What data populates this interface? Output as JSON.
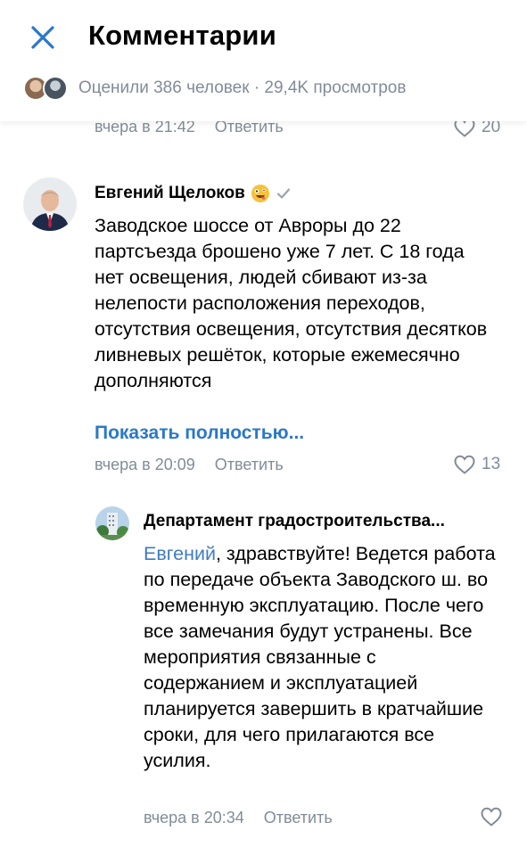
{
  "header": {
    "title": "Комментарии",
    "stats": "Оценили 386 человек · 29,4K просмотров"
  },
  "prev_comment": {
    "time": "вчера в 21:42",
    "reply_label": "Ответить",
    "likes": "20"
  },
  "comment": {
    "author": "Евгений Щелоков",
    "text": "Заводское шоссе от Авроры до 22 партсъезда брошено уже 7 лет. С 18 года нет освещения, людей сбивают из-за нелепости расположения переходов, отсутствия освещения, отсутствия десятков ливневых решёток, которые ежемесячно дополняются",
    "show_more": "Показать полностью...",
    "time": "вчера в 20:09",
    "reply_label": "Ответить",
    "likes": "13"
  },
  "reply": {
    "author": "Департамент градостроительства...",
    "mention": "Евгений",
    "text": ", здравствуйте! Ведется работа по передаче объекта Заводского ш. во временную эксплуатацию. После чего все замечания будут устранены. Все мероприятия связанные с содержанием и эксплуатацией планируется завершить в кратчайшие сроки, для чего прилагаются все усилия.",
    "time": "вчера в 20:34",
    "reply_label": "Ответить"
  },
  "colors": {
    "accent": "#2a78c9",
    "secondary_text": "#818c99"
  }
}
